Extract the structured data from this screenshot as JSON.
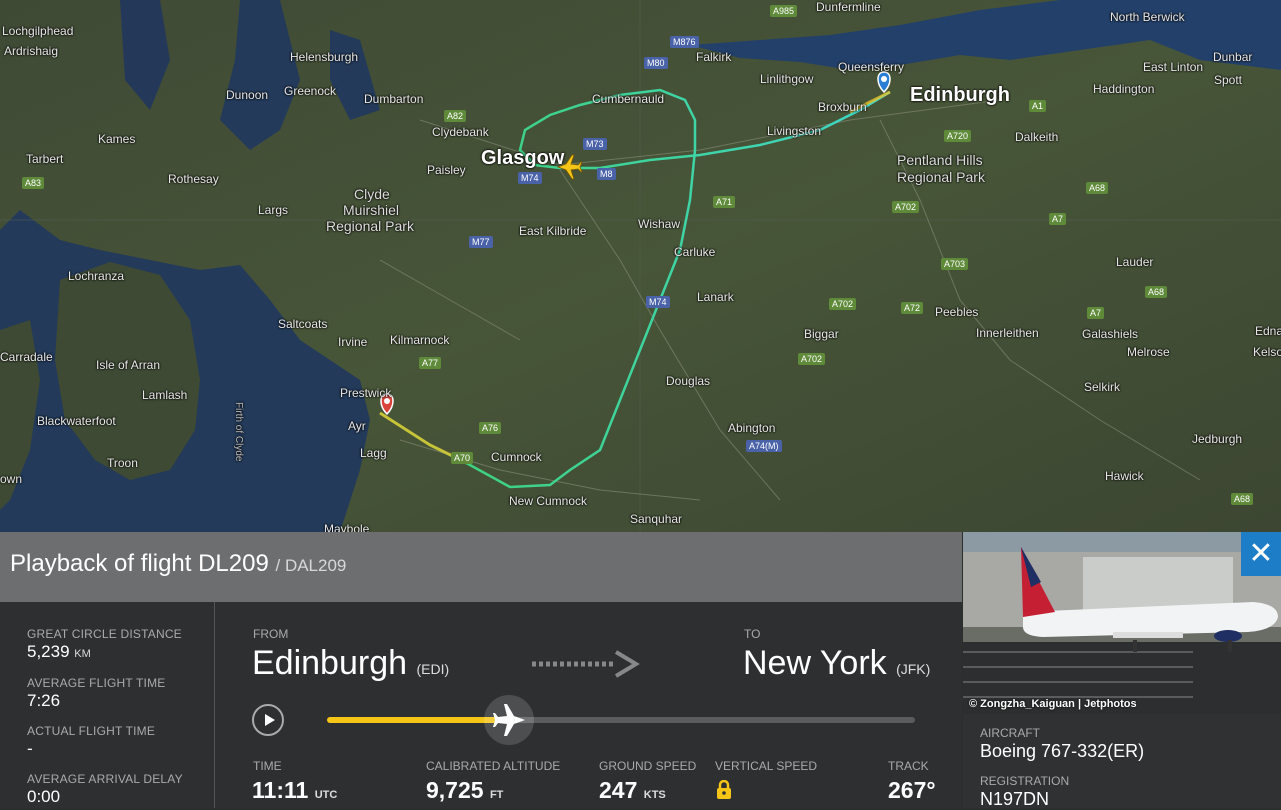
{
  "map": {
    "places": [
      {
        "name": "Lochgilphead",
        "cls": ""
      },
      {
        "name": "Ardrishaig",
        "cls": ""
      },
      {
        "name": "Helensburgh",
        "cls": ""
      },
      {
        "name": "Dunoon",
        "cls": ""
      },
      {
        "name": "Greenock",
        "cls": ""
      },
      {
        "name": "Dumbarton",
        "cls": ""
      },
      {
        "name": "Clydebank",
        "cls": ""
      },
      {
        "name": "Kames",
        "cls": ""
      },
      {
        "name": "Tarbert",
        "cls": ""
      },
      {
        "name": "Rothesay",
        "cls": ""
      },
      {
        "name": "Paisley",
        "cls": ""
      },
      {
        "name": "Glasgow",
        "cls": "big"
      },
      {
        "name": "Cumbernauld",
        "cls": ""
      },
      {
        "name": "Falkirk",
        "cls": ""
      },
      {
        "name": "Dunfermline",
        "cls": ""
      },
      {
        "name": "Linlithgow",
        "cls": ""
      },
      {
        "name": "Queensferry",
        "cls": ""
      },
      {
        "name": "Broxburn",
        "cls": ""
      },
      {
        "name": "Edinburgh",
        "cls": "big"
      },
      {
        "name": "Livingston",
        "cls": ""
      },
      {
        "name": "Dalkeith",
        "cls": ""
      },
      {
        "name": "North Berwick",
        "cls": ""
      },
      {
        "name": "Dunbar",
        "cls": ""
      },
      {
        "name": "East Linton",
        "cls": ""
      },
      {
        "name": "Spott",
        "cls": ""
      },
      {
        "name": "Haddington",
        "cls": ""
      },
      {
        "name": "Pentland Hills",
        "cls": "mid"
      },
      {
        "name": "Regional Park",
        "cls": "mid"
      },
      {
        "name": "Largs",
        "cls": ""
      },
      {
        "name": "Clyde",
        "cls": "mid"
      },
      {
        "name": "Muirshiel",
        "cls": "mid"
      },
      {
        "name": "Regional Park",
        "cls": "mid"
      },
      {
        "name": "East Kilbride",
        "cls": ""
      },
      {
        "name": "Wishaw",
        "cls": ""
      },
      {
        "name": "Carluke",
        "cls": ""
      },
      {
        "name": "Lanark",
        "cls": ""
      },
      {
        "name": "Lochranza",
        "cls": ""
      },
      {
        "name": "Saltcoats",
        "cls": ""
      },
      {
        "name": "Irvine",
        "cls": ""
      },
      {
        "name": "Kilmarnock",
        "cls": ""
      },
      {
        "name": "Carradale",
        "cls": ""
      },
      {
        "name": "Isle of Arran",
        "cls": ""
      },
      {
        "name": "Lamlash",
        "cls": ""
      },
      {
        "name": "Blackwaterfoot",
        "cls": ""
      },
      {
        "name": "Troon",
        "cls": ""
      },
      {
        "name": "Prestwick",
        "cls": ""
      },
      {
        "name": "Ayr",
        "cls": ""
      },
      {
        "name": "Lagg",
        "cls": ""
      },
      {
        "name": "Cumnock",
        "cls": ""
      },
      {
        "name": "New Cumnock",
        "cls": ""
      },
      {
        "name": "Sanquhar",
        "cls": ""
      },
      {
        "name": "Maybole",
        "cls": ""
      },
      {
        "name": "Douglas",
        "cls": ""
      },
      {
        "name": "Biggar",
        "cls": ""
      },
      {
        "name": "Abington",
        "cls": ""
      },
      {
        "name": "Peebles",
        "cls": ""
      },
      {
        "name": "Innerleithen",
        "cls": ""
      },
      {
        "name": "Lauder",
        "cls": ""
      },
      {
        "name": "Galashiels",
        "cls": ""
      },
      {
        "name": "Melrose",
        "cls": ""
      },
      {
        "name": "Selkirk",
        "cls": ""
      },
      {
        "name": "Jedburgh",
        "cls": ""
      },
      {
        "name": "Hawick",
        "cls": ""
      },
      {
        "name": "Edna",
        "cls": ""
      },
      {
        "name": "Kelso",
        "cls": ""
      },
      {
        "name": "Firth of Clyde",
        "cls": ""
      },
      {
        "name": "own",
        "cls": ""
      }
    ],
    "roads": [
      {
        "name": "A985",
        "type": "a"
      },
      {
        "name": "M876",
        "type": "m"
      },
      {
        "name": "M80",
        "type": "m"
      },
      {
        "name": "A82",
        "type": "a"
      },
      {
        "name": "M73",
        "type": "m"
      },
      {
        "name": "M74",
        "type": "m"
      },
      {
        "name": "M8",
        "type": "m"
      },
      {
        "name": "A71",
        "type": "a"
      },
      {
        "name": "A720",
        "type": "a"
      },
      {
        "name": "A1",
        "type": "a"
      },
      {
        "name": "A68",
        "type": "a"
      },
      {
        "name": "A7",
        "type": "a"
      },
      {
        "name": "A702",
        "type": "a"
      },
      {
        "name": "A703",
        "type": "a"
      },
      {
        "name": "M77",
        "type": "m"
      },
      {
        "name": "M74",
        "type": "m"
      },
      {
        "name": "A702",
        "type": "a"
      },
      {
        "name": "A72",
        "type": "a"
      },
      {
        "name": "A702",
        "type": "a"
      },
      {
        "name": "A77",
        "type": "a"
      },
      {
        "name": "A76",
        "type": "a"
      },
      {
        "name": "A70",
        "type": "a"
      },
      {
        "name": "A74(M)",
        "type": "m"
      },
      {
        "name": "A83",
        "type": "a"
      },
      {
        "name": "A7",
        "type": "a"
      },
      {
        "name": "A68",
        "type": "a"
      },
      {
        "name": "A68",
        "type": "a"
      }
    ]
  },
  "panel": {
    "title": "Playback of flight DL209",
    "callsign": "/ DAL209",
    "stats": [
      {
        "label": "GREAT CIRCLE DISTANCE",
        "value": "5,239",
        "unit": "KM"
      },
      {
        "label": "AVERAGE FLIGHT TIME",
        "value": "7:26",
        "unit": ""
      },
      {
        "label": "ACTUAL FLIGHT TIME",
        "value": "-",
        "unit": ""
      },
      {
        "label": "AVERAGE ARRIVAL DELAY",
        "value": "0:00",
        "unit": ""
      }
    ],
    "from_label": "FROM",
    "from_city": "Edinburgh",
    "from_code": "(EDI)",
    "to_label": "TO",
    "to_city": "New York",
    "to_code": "(JFK)",
    "playback_progress": 0.31,
    "telemetry": [
      {
        "label": "TIME",
        "value": "11:11",
        "unit": "UTC"
      },
      {
        "label": "CALIBRATED ALTITUDE",
        "value": "9,725",
        "unit": "FT"
      },
      {
        "label": "GROUND SPEED",
        "value": "247",
        "unit": "KTS"
      },
      {
        "label": "VERTICAL SPEED",
        "value": "",
        "unit": ""
      },
      {
        "label": "TRACK",
        "value": "267°",
        "unit": ""
      }
    ]
  },
  "aircraft": {
    "photo_credit": "© Zongzha_Kaiguan | Jetphotos",
    "aircraft_label": "AIRCRAFT",
    "aircraft_value": "Boeing 767-332(ER)",
    "registration_label": "REGISTRATION",
    "registration_value": "N197DN",
    "close_symbol": "✕"
  },
  "colors": {
    "accent": "#f5c518",
    "track_green": "#3ed170",
    "track_cyan": "#3fd6c8",
    "close_bg": "#1d7ec7"
  }
}
